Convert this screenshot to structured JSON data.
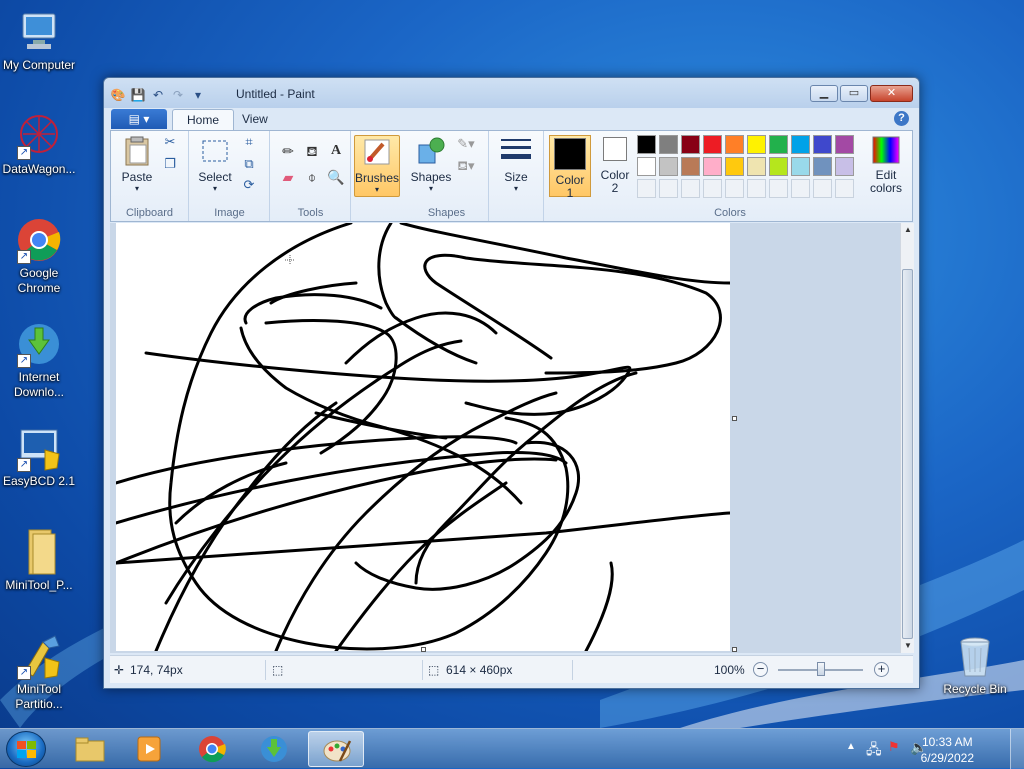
{
  "desktop": {
    "icons": [
      {
        "label": "My Computer"
      },
      {
        "label": "DataWagon..."
      },
      {
        "label": "Google Chrome"
      },
      {
        "label": "Internet Downlo..."
      },
      {
        "label": "EasyBCD 2.1"
      },
      {
        "label": "MiniTool_P..."
      },
      {
        "label": "MiniTool Partitio..."
      },
      {
        "label": "Recycle Bin"
      }
    ]
  },
  "window": {
    "title": "Untitled - Paint",
    "file_tab": "▤ ▾",
    "tabs": [
      "Home",
      "View"
    ],
    "ribbon": {
      "clipboard": {
        "label": "Clipboard",
        "paste": "Paste"
      },
      "image": {
        "label": "Image",
        "select": "Select"
      },
      "tools": {
        "label": "Tools"
      },
      "brushes": {
        "label": "Brushes"
      },
      "shapes": {
        "label": "Shapes",
        "shapes_btn": "Shapes"
      },
      "size": {
        "label": "Size"
      },
      "colors": {
        "label": "Colors",
        "color1": "Color",
        "color1_num": "1",
        "color2": "Color",
        "color2_num": "2",
        "edit": "Edit",
        "edit2": "colors",
        "color1_value": "#000000",
        "color2_value": "#ffffff",
        "palette_row1": [
          "#000000",
          "#7f7f7f",
          "#880015",
          "#ed1c24",
          "#ff7f27",
          "#fff200",
          "#22b14c",
          "#00a2e8",
          "#3f48cc",
          "#a349a4"
        ],
        "palette_row2": [
          "#ffffff",
          "#c3c3c3",
          "#b97a57",
          "#ffaec9",
          "#ffc90e",
          "#efe4b0",
          "#b5e61d",
          "#99d9ea",
          "#7092be",
          "#c8bfe7"
        ]
      }
    },
    "status": {
      "cursor_pos": "174, 74px",
      "canvas_size": "614 × 460px",
      "zoom": "100%"
    }
  },
  "taskbar": {
    "time": "10:33 AM",
    "date": "6/29/2022"
  }
}
